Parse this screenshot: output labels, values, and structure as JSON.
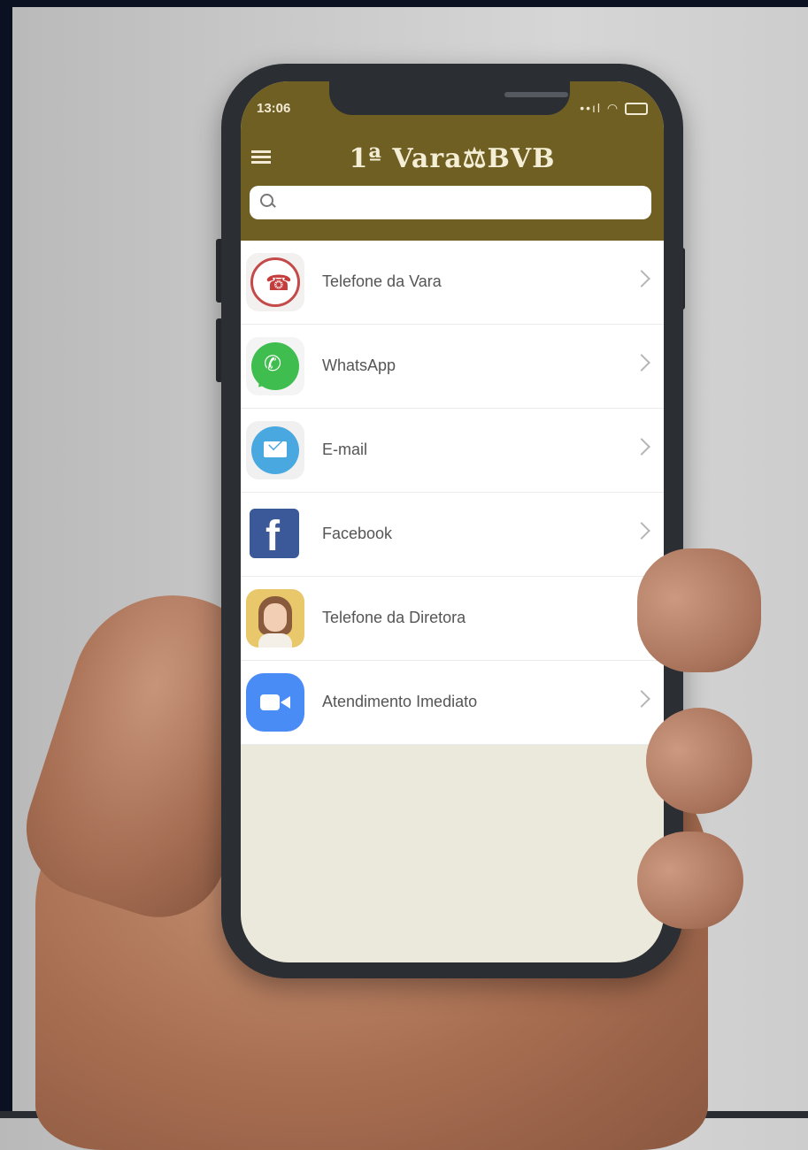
{
  "status_bar": {
    "time": "13:06",
    "icons": "••ıl ◠"
  },
  "header": {
    "title": "1ª Vara⚖BVB",
    "bg_color": "#6f5f23"
  },
  "search": {
    "placeholder": "",
    "value": ""
  },
  "list": {
    "items": [
      {
        "label": "Telefone da Vara",
        "icon": "phone-call-icon"
      },
      {
        "label": "WhatsApp",
        "icon": "whatsapp-icon"
      },
      {
        "label": "E-mail",
        "icon": "email-icon"
      },
      {
        "label": "Facebook",
        "icon": "facebook-icon"
      },
      {
        "label": "Telefone da Diretora",
        "icon": "avatar-icon"
      },
      {
        "label": "Atendimento Imediato",
        "icon": "video-camera-icon"
      }
    ]
  },
  "icons": {
    "phone_glyph": "☎",
    "whatsapp_glyph": "✆",
    "facebook_glyph": "f"
  },
  "colors": {
    "header": "#6f5f23",
    "screen_bg": "#ebe8dc",
    "facebook": "#3b5998",
    "whatsapp": "#3fbe4f",
    "zoom": "#4a8cf6"
  }
}
